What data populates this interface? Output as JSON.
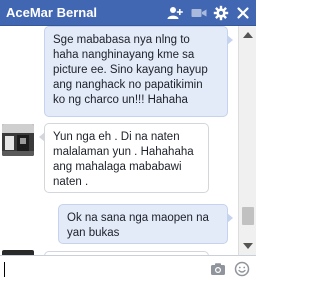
{
  "header": {
    "name": "AceMar Bernal",
    "icons": [
      "add-friend-icon",
      "video-call-icon",
      "gear-icon",
      "close-icon"
    ],
    "color": "#4267b2"
  },
  "messages": [
    {
      "direction": "outgoing",
      "lines": [
        "Sge mababasa nya nlng to",
        "haha nanghinayang kme sa",
        "picture ee. Sino kayang hayup",
        "ang nanghack no papatikimin",
        "ko ng charco un!!! Hahaha"
      ]
    },
    {
      "direction": "incoming",
      "lines": [
        "Yun nga  eh . Di na naten",
        "malalaman yun . Hahahaha",
        "ang mahalaga mababawi",
        "naten ."
      ]
    },
    {
      "direction": "outgoing",
      "lines": [
        "Ok na sana nga maopen na",
        "yan bukas"
      ]
    }
  ],
  "composer": {
    "value": "",
    "placeholder": "",
    "icons": [
      "camera-icon",
      "emoji-icon"
    ]
  },
  "colors": {
    "outgoing_bubble": "#e3eaf8",
    "incoming_bubble": "#ffffff"
  }
}
